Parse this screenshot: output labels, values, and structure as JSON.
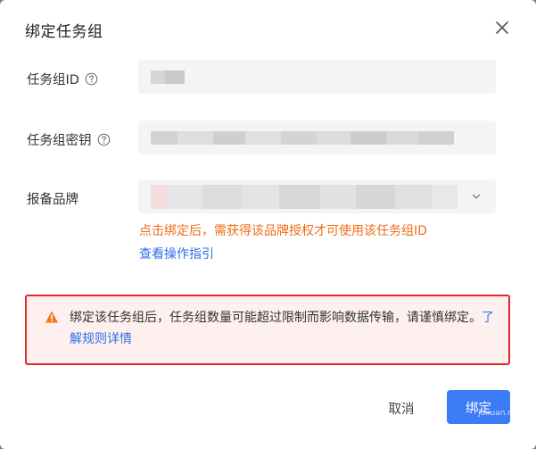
{
  "dialog": {
    "title": "绑定任务组"
  },
  "form": {
    "task_group_id_label": "任务组ID",
    "task_group_key_label": "任务组密钥",
    "brand_label": "报备品牌"
  },
  "hints": {
    "warning": "点击绑定后，需获得该品牌授权才可使用该任务组ID",
    "guide_link": "查看操作指引"
  },
  "alert": {
    "text": "绑定该任务组后，任务组数量可能超过限制而影响数据传输，请谨慎绑定。",
    "link": "了解规则详情"
  },
  "buttons": {
    "cancel": "取消",
    "confirm": "绑定"
  },
  "watermark": "juxuan.n",
  "colors": {
    "primary": "#3b7bf6",
    "warning_text": "#ef6c1a",
    "link": "#2f6fe4",
    "alert_border": "#e02a2a"
  },
  "icons": {
    "close": "close-icon",
    "help": "question-circle-icon",
    "alert": "warning-triangle-icon",
    "select": "chevron-down-icon"
  }
}
